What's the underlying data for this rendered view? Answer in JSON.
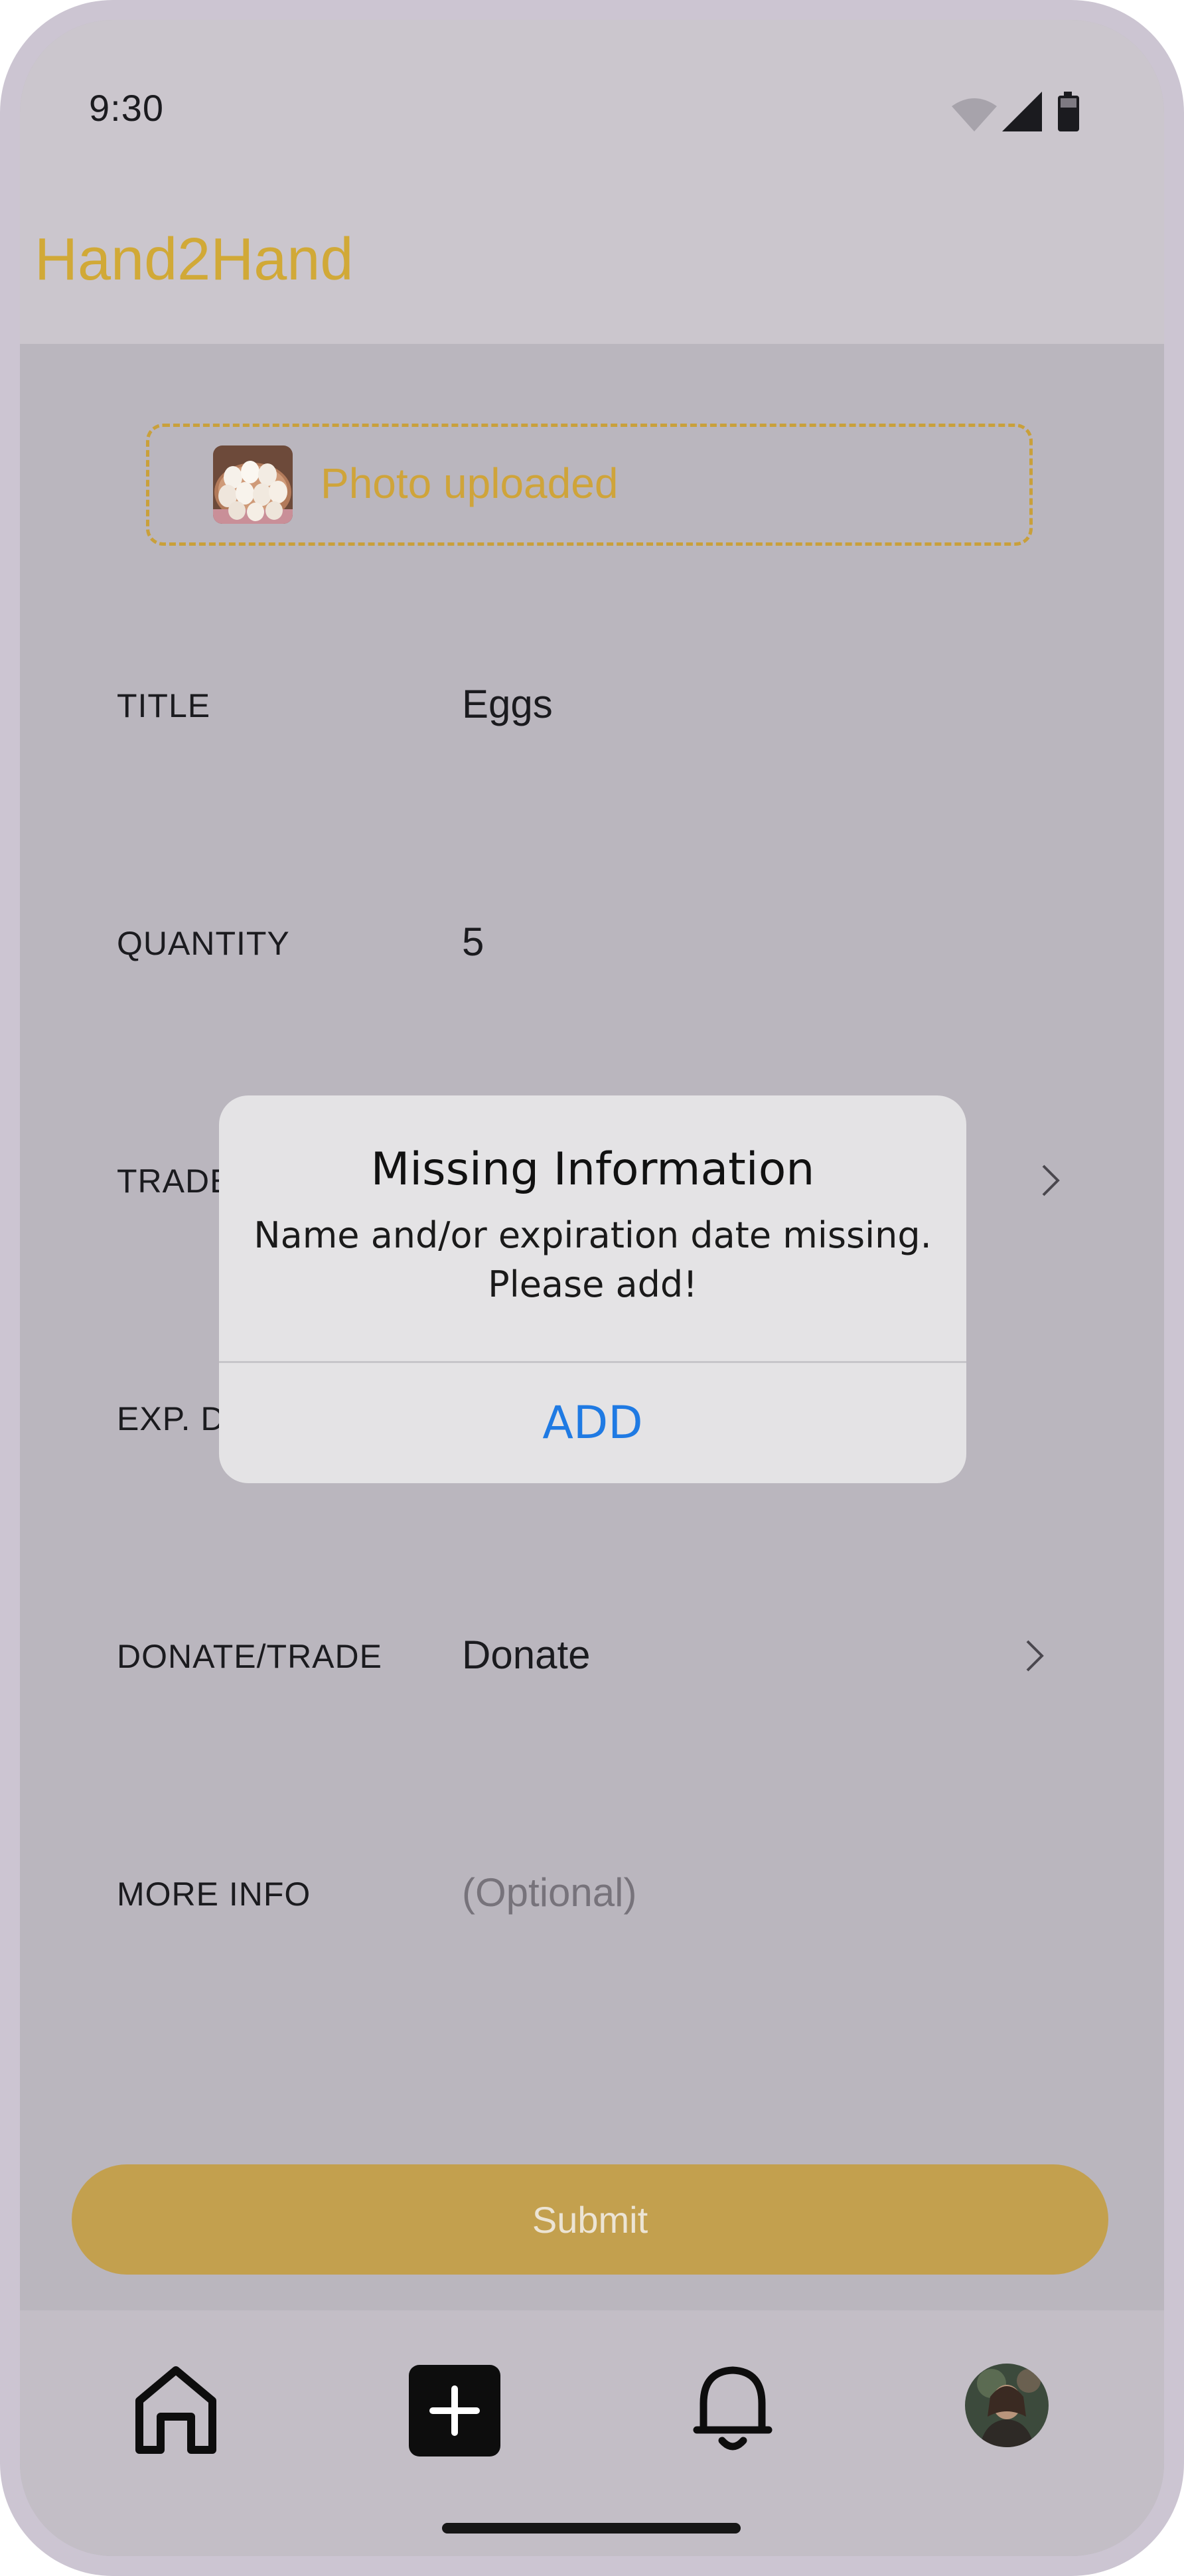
{
  "status_bar": {
    "time": "9:30",
    "icons": [
      "wifi-icon",
      "signal-icon",
      "battery-icon"
    ]
  },
  "app": {
    "title": "Hand2Hand",
    "accent_color": "#d1a937"
  },
  "photo": {
    "label": "Photo uploaded",
    "thumbnail": "eggs-photo"
  },
  "form": {
    "title": {
      "label": "TITLE",
      "value": "Eggs"
    },
    "quantity": {
      "label": "QUANTITY",
      "value": "5"
    },
    "trade": {
      "label": "TRADE"
    },
    "exp_date": {
      "label": "EXP. D"
    },
    "donate_trade": {
      "label": "DONATE/TRADE",
      "value": "Donate"
    },
    "more_info": {
      "label": "MORE INFO",
      "placeholder": "(Optional)"
    }
  },
  "submit": {
    "label": "Submit",
    "color": "#c3a04e"
  },
  "dialog": {
    "title": "Missing Information",
    "message": "Name and/or expiration date missing. Please add!",
    "action_label": "ADD",
    "action_color": "#1f7ae3"
  },
  "bottom_nav": {
    "items": [
      "home-icon",
      "add-icon",
      "bell-icon",
      "profile-avatar"
    ]
  }
}
